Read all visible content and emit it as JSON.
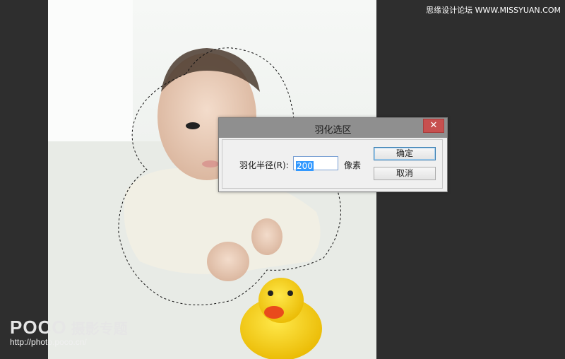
{
  "watermark": {
    "top_text": "思缘设计论坛 WWW.MISSYUAN.COM",
    "logo": "POCO",
    "logo_sub": "摄影专题",
    "url": "http://photo.poco.cn/"
  },
  "dialog": {
    "title": "羽化选区",
    "close_label": "✕",
    "radius_label": "羽化半径(R):",
    "radius_value": "200",
    "unit_label": "像素",
    "ok_label": "确定",
    "cancel_label": "取消"
  },
  "colors": {
    "titlebar": "#8f8f8f",
    "close_button": "#c7504f",
    "selection_highlight": "#3399ff",
    "workspace": "#2d2d2d"
  }
}
